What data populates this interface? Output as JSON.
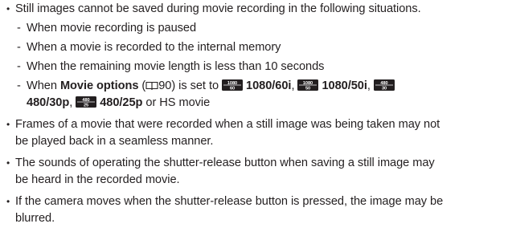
{
  "bullet1": {
    "text": "Still images cannot be saved during movie recording in the following situations."
  },
  "subitems": [
    "When movie recording is paused",
    "When a movie is recorded to the internal memory",
    "When the remaining movie length is less than 10 seconds"
  ],
  "sub4": {
    "prefix": "When ",
    "bold_term": "Movie options",
    "paren_open": " (",
    "page_ref": "90",
    "paren_close": ") is set to ",
    "opt1_label": "1080/60i",
    "opt1_icon": {
      "top": "1080",
      "bottom": "60"
    },
    "sep1": ", ",
    "opt2_label": "1080/50i",
    "opt2_icon": {
      "top": "1080",
      "bottom": "50"
    },
    "sep2": ", ",
    "opt3_label": "480/30p",
    "opt3_icon": {
      "top": "480",
      "bottom": "30"
    },
    "sep3": ", ",
    "opt4_label": "480/25p",
    "opt4_icon": {
      "top": "480",
      "bottom": "25"
    },
    "suffix": " or HS movie"
  },
  "bullet2": {
    "line1": "Frames of a movie that were recorded when a still image was being taken may not",
    "line2": "be played back in a seamless manner."
  },
  "bullet3": {
    "line1": "The sounds of operating the shutter-release button when saving a still image may",
    "line2": "be heard in the recorded movie."
  },
  "bullet4": {
    "line1": "If the camera moves when the shutter-release button is pressed, the image may be",
    "line2": "blurred."
  },
  "icons": {
    "bullet": "bullet-dot",
    "page_ref": "book-reference-icon",
    "mode": "movie-mode-icon"
  },
  "colors": {
    "text": "#231f20",
    "icon": "#231f20"
  }
}
